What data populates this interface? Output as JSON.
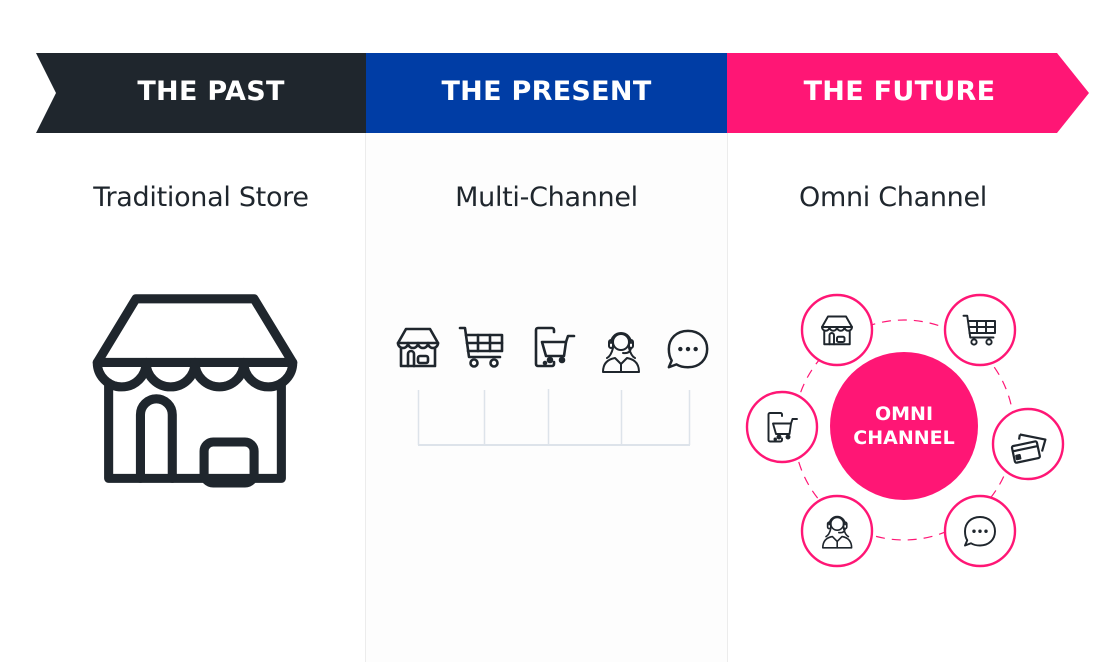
{
  "banners": [
    {
      "label": "THE PAST",
      "color": "#1f262d"
    },
    {
      "label": "THE PRESENT",
      "color": "#003da5"
    },
    {
      "label": "THE FUTURE",
      "color": "#ff1675"
    }
  ],
  "columns": [
    {
      "title": "Traditional Store",
      "icon": "storefront-icon"
    },
    {
      "title": "Multi-Channel",
      "icons": [
        "storefront-icon",
        "shopping-cart-icon",
        "mobile-shopping-icon",
        "support-agent-icon",
        "chat-bubble-icon"
      ]
    },
    {
      "title": "Omni Channel",
      "center_label_line1": "OMNI",
      "center_label_line2": "CHANNEL",
      "satellites": [
        "storefront-icon",
        "shopping-cart-icon",
        "mobile-shopping-icon",
        "credit-cards-icon",
        "support-agent-icon",
        "chat-bubble-icon"
      ]
    }
  ],
  "colors": {
    "dark": "#1f262d",
    "blue": "#003da5",
    "pink": "#ff1675",
    "connector": "#dde3ea"
  }
}
